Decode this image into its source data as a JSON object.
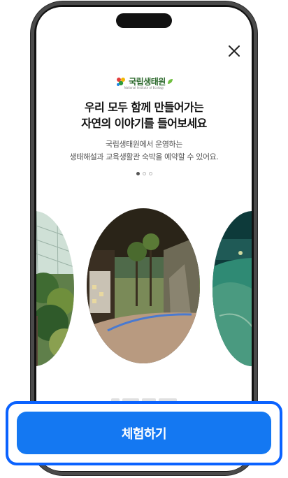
{
  "logo": {
    "name": "국립생태원",
    "subtitle": "National Institute of Ecology"
  },
  "onboarding": {
    "title_line1": "우리 모두 함께 만들어가는",
    "title_line2": "자연의 이야기를 들어보세요",
    "desc_line1": "국립생태원에서 운영하는",
    "desc_line2": "생태해설과 교육생활관 숙박을 예약할 수 있어요.",
    "page_indicator": {
      "total": 3,
      "current": 1
    }
  },
  "icons": {
    "close": "close-icon",
    "logo": "nie-logo-icon"
  },
  "cta": {
    "label": "체험하기"
  },
  "colors": {
    "accent": "#1478f2",
    "highlight": "#0a62ff"
  }
}
